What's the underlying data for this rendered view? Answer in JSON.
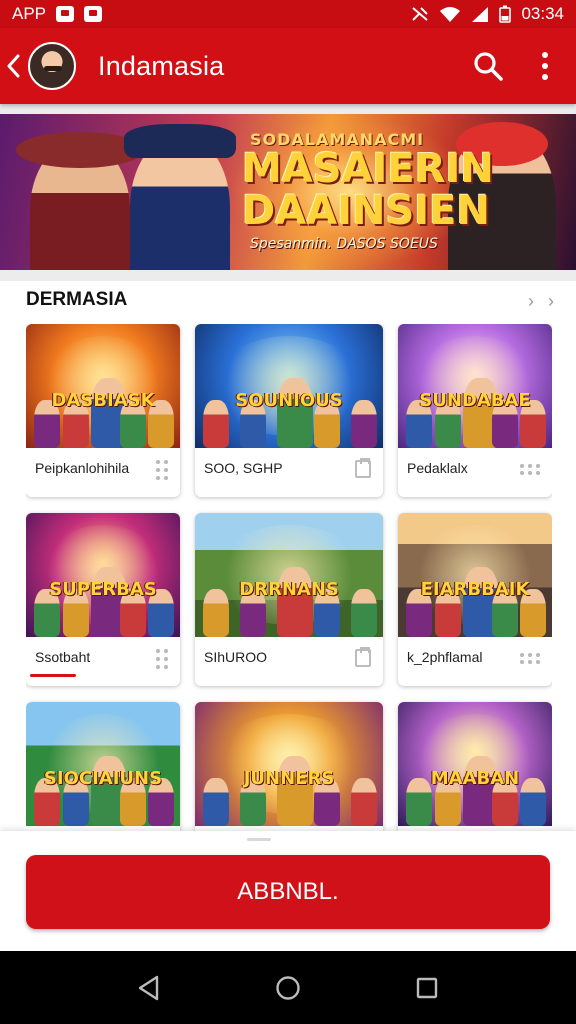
{
  "status_bar": {
    "app_label": "APP",
    "time": "03:34"
  },
  "app_bar": {
    "title": "Indamasia",
    "icons": [
      "back-arrow-icon",
      "search-icon",
      "more-vert-icon"
    ]
  },
  "banner": {
    "top_text": "SODALAMANACMI",
    "title_line1": "MASAIERIN",
    "title_line2": "DAAINSIEN",
    "subtitle": "Spesanmin. DASOS SOEUS"
  },
  "section": {
    "title": "DERMASIA",
    "nav_icons": [
      "chevron-left-icon",
      "chevron-right-icon"
    ]
  },
  "cards": [
    {
      "art_title": "DASBIASK",
      "label": "Peipkanlohihila",
      "action_icon": "drag-dots-icon",
      "theme": "t-orange"
    },
    {
      "art_title": "SOUNIOUS",
      "label": "SOO, SGHP",
      "action_icon": "clipboard-icon",
      "theme": "t-blue"
    },
    {
      "art_title": "SUNDABAE",
      "label": "Pedaklalx",
      "action_icon": "more-dots-icon",
      "theme": "t-purple"
    },
    {
      "art_title": "SUPERBAS",
      "label": "Ssotbaht",
      "action_icon": "drag-dots-icon",
      "theme": "t-magenta",
      "progress": 0.3
    },
    {
      "art_title": "DRRNANS",
      "label": "SIhUROO",
      "action_icon": "clipboard-icon",
      "theme": "t-green"
    },
    {
      "art_title": "EIARBBAIK",
      "label": "k_2phflamal",
      "action_icon": "more-dots-icon",
      "theme": "t-city"
    },
    {
      "art_title": "SIOCIAIUNS",
      "label": "",
      "action_icon": "",
      "theme": "t-jungle"
    },
    {
      "art_title": "JUNNERS",
      "label": "",
      "action_icon": "",
      "theme": "t-sunburst"
    },
    {
      "art_title": "MAABAN",
      "label": "",
      "action_icon": "",
      "theme": "t-violet"
    }
  ],
  "cta": {
    "label": "ABBNBL."
  },
  "nav_bar": {
    "icons": [
      "back-triangle-icon",
      "home-circle-icon",
      "recents-square-icon"
    ]
  },
  "colors": {
    "brand_red": "#d10f15",
    "status_red": "#c70d12",
    "cta_red": "#d0111a"
  }
}
